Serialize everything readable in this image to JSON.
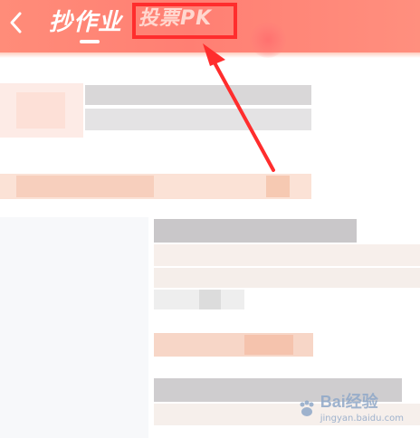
{
  "header": {
    "tabs": [
      {
        "label": "抄作业"
      },
      {
        "label": "投票PK"
      }
    ],
    "active_tab": 0,
    "highlighted_tab": 1
  },
  "watermark": {
    "brand": "Bai",
    "brand2": "经验",
    "sub": "jingyan.baidu.com"
  },
  "colors": {
    "header": "#ff8273",
    "highlight": "#ff2d2d",
    "arrow": "#ff2d2d"
  },
  "icons": [
    "chevron-left-icon",
    "baidu-paw-icon"
  ]
}
